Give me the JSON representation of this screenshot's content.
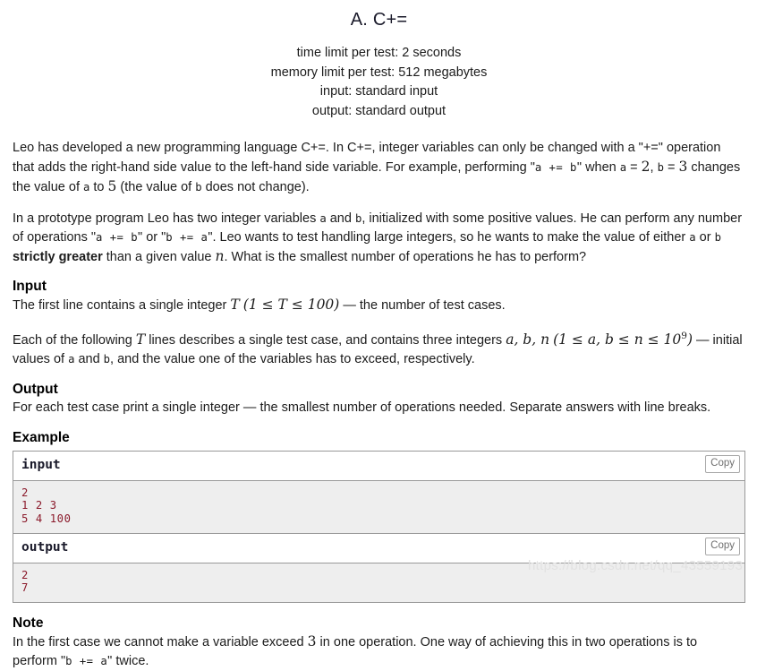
{
  "header": {
    "title": "A. C+=",
    "time_limit": "time limit per test: 2 seconds",
    "memory_limit": "memory limit per test: 512 megabytes",
    "input_mode": "input: standard input",
    "output_mode": "output: standard output"
  },
  "legend": {
    "p1_part1": "Leo has developed a new programming language C+=. In C+=, integer variables can only be changed with a \"+=\" operation that adds the right-hand side value to the left-hand side variable. For example, performing \"",
    "p1_code1": "a += b",
    "p1_part2": "\" when ",
    "p1_var_a": "a",
    "p1_eq1": " = ",
    "p1_num2": "2",
    "p1_sep": ", ",
    "p1_var_b": "b",
    "p1_eq2": " = ",
    "p1_num3": "3",
    "p1_part3": " changes the value of ",
    "p1_var_a2": "a",
    "p1_to": " to ",
    "p1_num5": "5",
    "p1_part4": " (the value of ",
    "p1_var_b2": "b",
    "p1_part5": " does not change).",
    "p2_part1": "In a prototype program Leo has two integer variables ",
    "p2_var_a": "a",
    "p2_and": " and ",
    "p2_var_b": "b",
    "p2_part2": ", initialized with some positive values. He can perform any number of operations \"",
    "p2_code1": "a += b",
    "p2_or": "\" or \"",
    "p2_code2": "b += a",
    "p2_part3": "\". Leo wants to test handling large integers, so he wants to make the value of either ",
    "p2_var_a2": "a",
    "p2_or2": " or ",
    "p2_var_b2": "b",
    "p2_space": " ",
    "p2_bold": "strictly greater",
    "p2_part4": " than a given value ",
    "p2_var_n": "n",
    "p2_part5": ". What is the smallest number of operations he has to perform?"
  },
  "input_section": {
    "title": "Input",
    "p1_part1": "The first line contains a single integer ",
    "p1_math_T": "T",
    "p1_math_range": "(1 ≤ T ≤ 100)",
    "p1_part2": " — the number of test cases.",
    "p2_part1": "Each of the following ",
    "p2_math_T": "T",
    "p2_part2": " lines describes a single test case, and contains three integers ",
    "p2_math_abn": "a, b, n",
    "p2_math_range_open": "(1 ≤ a, b ≤ n ≤ 10",
    "p2_math_exp": "9",
    "p2_math_range_close": ")",
    "p2_part3": " — initial values of ",
    "p2_var_a": "a",
    "p2_and": " and ",
    "p2_var_b": "b",
    "p2_part4": ", and the value one of the variables has to exceed, respectively."
  },
  "output_section": {
    "title": "Output",
    "p1": "For each test case print a single integer — the smallest number of operations needed. Separate answers with line breaks."
  },
  "example_section": {
    "title": "Example",
    "tests": [
      {
        "label": "input",
        "copy_label": "Copy",
        "lines": [
          "2",
          "1 2 3",
          "5 4 100"
        ]
      },
      {
        "label": "output",
        "copy_label": "Copy",
        "lines": [
          "2",
          "7"
        ]
      }
    ]
  },
  "note_section": {
    "title": "Note",
    "p1_part1": "In the first case we cannot make a variable exceed ",
    "p1_num3": "3",
    "p1_part2": " in one operation. One way of achieving this in two operations is to perform \"",
    "p1_code": "b += a",
    "p1_part3": "\" twice."
  },
  "watermark": {
    "text": "https://blog.csdn.net/qq_43559193"
  },
  "colors": {
    "sample_text": "#8b1a2b",
    "sample_bg": "#eeeeee",
    "border": "#999999",
    "title": "#1b1b2b"
  }
}
